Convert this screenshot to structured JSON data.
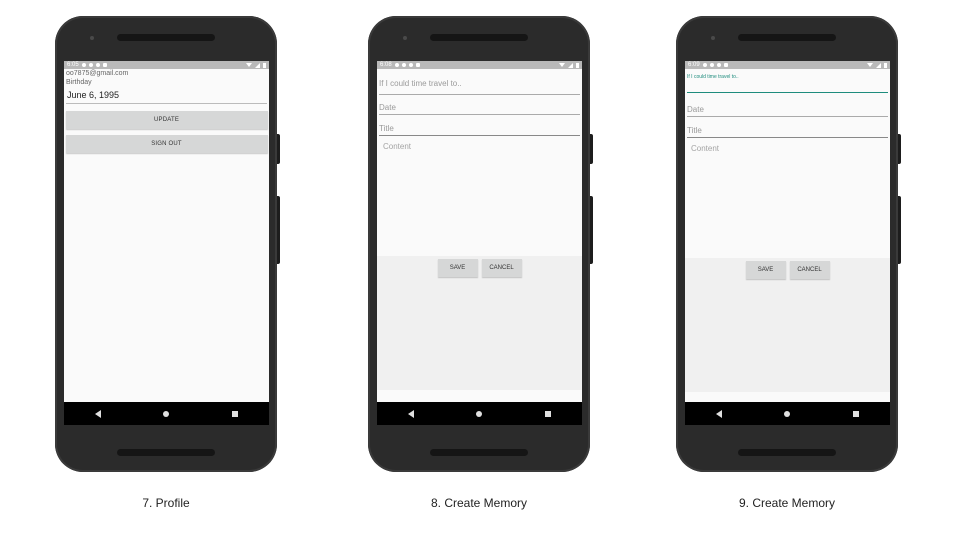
{
  "profile": {
    "status_time": "6:05",
    "email": "oo7875@gmail.com",
    "birthday_label": "Birthday",
    "birthday_value": "June 6, 1995",
    "update_label": "UPDATE",
    "signout_label": "SIGN OUT",
    "caption": "7. Profile"
  },
  "memory1": {
    "status_time": "6:08",
    "title_placeholder": "If I could time travel to..",
    "date_placeholder": "Date",
    "title2_placeholder": "Title",
    "content_placeholder": "Content",
    "save_label": "SAVE",
    "cancel_label": "CANCEL",
    "caption": "8. Create Memory"
  },
  "memory2": {
    "status_time": "6:09",
    "title_hint": "If I could time travel to..",
    "date_placeholder": "Date",
    "title2_placeholder": "Title",
    "content_placeholder": "Content",
    "save_label": "SAVE",
    "cancel_label": "CANCEL",
    "caption": "9. Create Memory"
  },
  "colors": {
    "accent": "#1e8c7d",
    "button_bg": "#d6d7d7",
    "phone_body": "#2b2b2b"
  }
}
